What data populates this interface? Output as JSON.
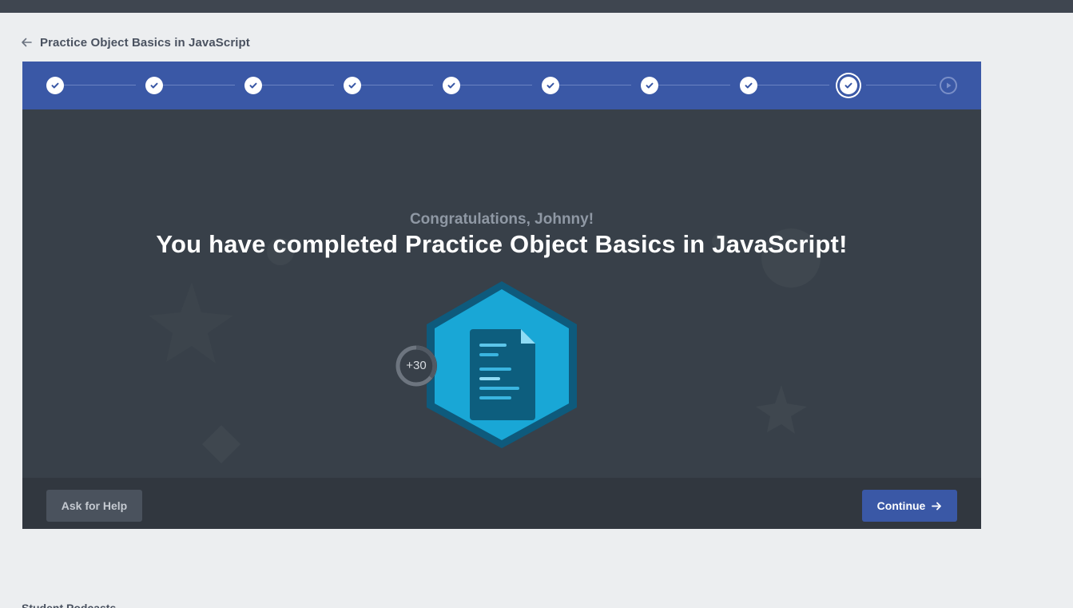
{
  "header": {
    "back_icon": "arrow-left-icon",
    "title": "Practice Object Basics in JavaScript"
  },
  "progress": {
    "total_steps": 10,
    "completed_steps": 9,
    "current_step": 9,
    "colors": {
      "bar": "#3a58a6",
      "complete": "#ffffff",
      "pending": "#7a8fc8"
    }
  },
  "completion": {
    "greeting": "Congratulations, Johnny!",
    "headline": "You have completed Practice Object Basics in JavaScript!",
    "badge_icon": "document-icon",
    "xp_label": "+30",
    "colors": {
      "badge_outer": "#0e5a7c",
      "badge_inner": "#19a7d6"
    }
  },
  "footer": {
    "help_label": "Ask for Help",
    "continue_label": "Continue",
    "continue_icon": "arrow-right-icon"
  },
  "below": {
    "section_label": "Student Podcasts"
  }
}
